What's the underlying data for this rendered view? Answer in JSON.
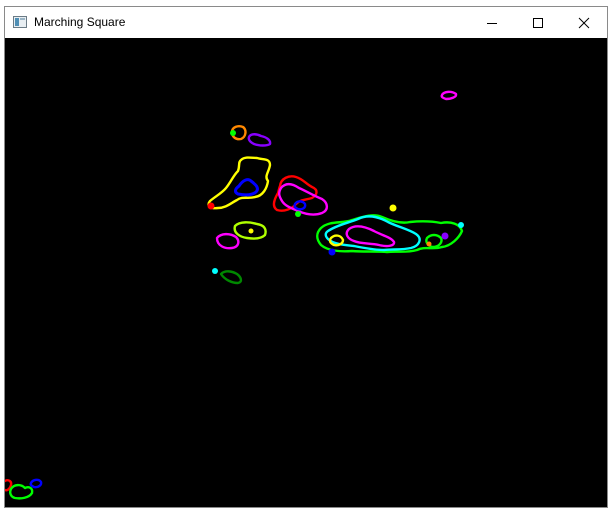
{
  "window": {
    "title": "Marching Square",
    "icon": "app-window-icon",
    "controls": {
      "minimize_icon": "minimize-icon",
      "maximize_icon": "maximize-icon",
      "close_icon": "close-icon"
    }
  },
  "canvas": {
    "background": "#000000",
    "contour_colors": [
      "#ffff00",
      "#0000ff",
      "#ff0000",
      "#ff00ff",
      "#00ff00",
      "#00ffff",
      "#ff8800",
      "#8800ff",
      "#008800"
    ]
  }
}
